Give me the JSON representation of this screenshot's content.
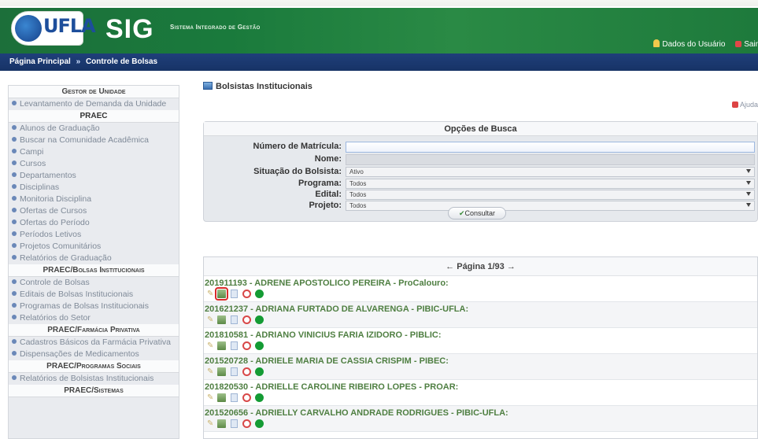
{
  "header": {
    "logo_text": "UFLA",
    "app_name": "SIG",
    "app_subtitle": "Sistema Integrado de Gestão",
    "user_link": "Dados do Usuário",
    "exit_link": "Sair"
  },
  "breadcrumb": {
    "home": "Página Principal",
    "separator": "»",
    "current": "Controle de Bolsas"
  },
  "sidebar": {
    "sections": [
      {
        "title": "Gestor de Unidade",
        "smallcaps": true,
        "items": [
          "Levantamento de Demanda da Unidade"
        ]
      },
      {
        "title": "PRAEC",
        "smallcaps": false,
        "items": [
          "Alunos de Graduação",
          "Buscar na Comunidade Acadêmica",
          "Campi",
          "Cursos",
          "Departamentos",
          "Disciplinas",
          "Monitoria Disciplina",
          "Ofertas de Cursos",
          "Ofertas do Período",
          "Períodos Letivos",
          "Projetos Comunitários",
          "Relatórios de Graduação"
        ]
      },
      {
        "title": "PRAEC/Bolsas Institucionais",
        "smallcaps": true,
        "items": [
          "Controle de Bolsas",
          "Editais de Bolsas Institucionais",
          "Programas de Bolsas Institucionais",
          "Relatórios do Setor"
        ]
      },
      {
        "title": "PRAEC/Farmácia Privativa",
        "smallcaps": true,
        "items": [
          "Cadastros Básicos da Farmácia Privativa",
          "Dispensações de Medicamentos"
        ]
      },
      {
        "title": "PRAEC/Programas Sociais",
        "smallcaps": true,
        "items": [
          "Relatórios de Bolsistas Institucionais"
        ]
      },
      {
        "title": "PRAEC/Sistemas",
        "smallcaps": true,
        "items": []
      }
    ]
  },
  "main": {
    "page_title": "Bolsistas Institucionais",
    "help_label": "Ajuda",
    "search": {
      "title": "Opções de Busca",
      "fields": {
        "matricula_label": "Número de Matrícula:",
        "matricula_value": "",
        "nome_label": "Nome:",
        "nome_value": "",
        "situacao_label": "Situação do Bolsista:",
        "situacao_value": "Ativo",
        "programa_label": "Programa:",
        "programa_value": "Todos",
        "edital_label": "Edital:",
        "edital_value": "Todos",
        "projeto_label": "Projeto:",
        "projeto_value": "Todos"
      },
      "submit_label": "Consultar"
    },
    "pager": "← Página 1/93 →",
    "results": [
      "201911193 - ADRENE APOSTOLICO PEREIRA - ProCalouro:",
      "201621237 - ADRIANA FURTADO DE ALVARENGA - PIBIC-UFLA:",
      "201810581 - ADRIANO VINICIUS FARIA IZIDORO - PIBLIC:",
      "201520728 - ADRIELE MARIA DE CASSIA CRISPIM - PIBEC:",
      "201820530 - ADRIELLE CAROLINE RIBEIRO LOPES - PROAR:",
      "201520656 - ADRIELLY CARVALHO ANDRADE RODRIGUES - PIBIC-UFLA:"
    ]
  }
}
